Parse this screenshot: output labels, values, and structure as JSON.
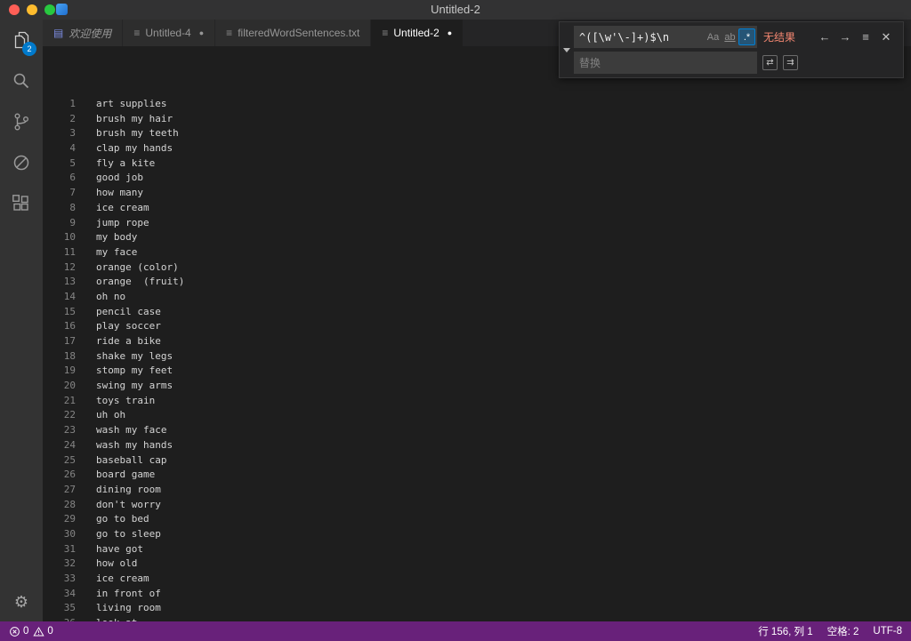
{
  "window": {
    "title": "Untitled-2"
  },
  "activity_bar": {
    "explorer_badge": "2"
  },
  "tabs": [
    {
      "label": "欢迎使用",
      "preview": true,
      "modified": false,
      "active": false,
      "icon": "welcome"
    },
    {
      "label": "Untitled-4",
      "preview": false,
      "modified": true,
      "active": false,
      "icon": "text"
    },
    {
      "label": "filteredWordSentences.txt",
      "preview": false,
      "modified": false,
      "active": false,
      "icon": "text"
    },
    {
      "label": "Untitled-2",
      "preview": false,
      "modified": true,
      "active": true,
      "icon": "text"
    }
  ],
  "find": {
    "query": "^([\\w'\\-]+)$\\n",
    "match_case_label": "Aa",
    "whole_word_label": "ab",
    "regex_label": ".*",
    "results_text": "无结果",
    "replace_placeholder": "替换"
  },
  "editor": {
    "lines": [
      "art supplies",
      "brush my hair",
      "brush my teeth",
      "clap my hands",
      "fly a kite",
      "good job",
      "how many",
      "ice cream",
      "jump rope",
      "my body",
      "my face",
      "orange (color)",
      "orange  (fruit)",
      "oh no",
      "pencil case",
      "play soccer",
      "ride a bike",
      "shake my legs",
      "stomp my feet",
      "swing my arms",
      "toys train",
      "uh oh",
      "wash my face",
      "wash my hands",
      "baseball cap",
      "board game",
      "dining room",
      "don't worry",
      "go to bed",
      "go to sleep",
      "have got",
      "how old",
      "ice cream",
      "in front of",
      "living room",
      "look at"
    ]
  },
  "status_bar": {
    "errors": "0",
    "warnings": "0",
    "cursor_position": "行 156, 列 1",
    "indentation": "空格: 2",
    "encoding": "UTF-8"
  }
}
